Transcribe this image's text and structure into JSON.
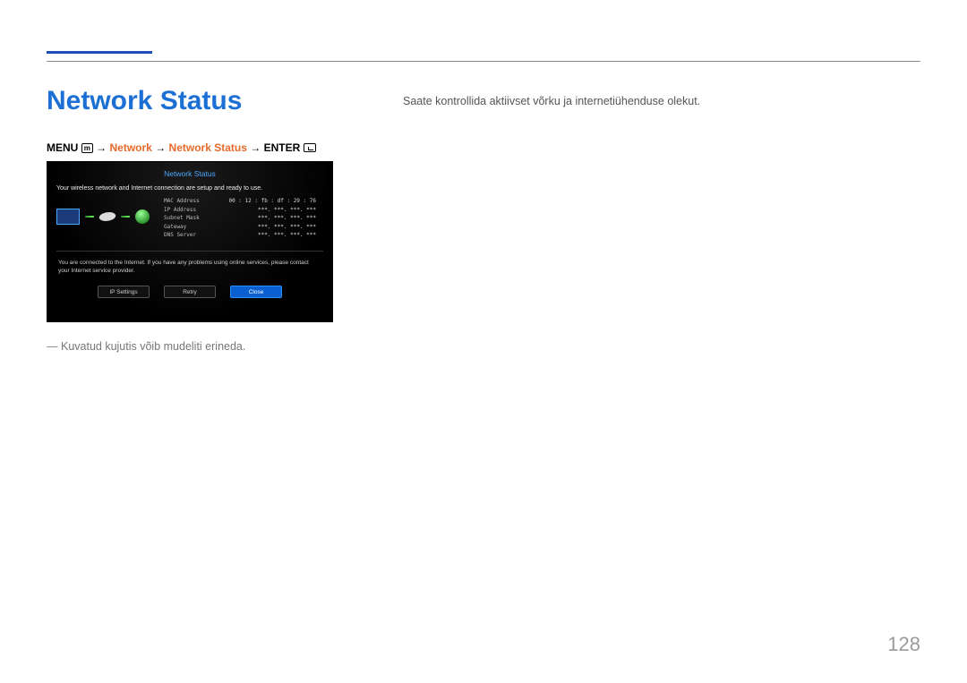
{
  "page_title": "Network Status",
  "right_description": "Saate kontrollida aktiivset võrku ja internetiühenduse olekut.",
  "menu_path": {
    "p1": "MENU",
    "arrow": "→",
    "p2": "Network",
    "p3": "Network Status",
    "p4": "ENTER"
  },
  "tv": {
    "title": "Network Status",
    "msg1": "Your wireless network and Internet connection are setup and ready to use.",
    "details": [
      {
        "lbl": "MAC Address",
        "val": "00 : 12 : fb : df : 29 : 76"
      },
      {
        "lbl": "IP Address",
        "val": "***.  ***.  ***.  ***"
      },
      {
        "lbl": "Subnet Mask",
        "val": "***.  ***.  ***.  ***"
      },
      {
        "lbl": "Gateway",
        "val": "***.  ***.  ***.  ***"
      },
      {
        "lbl": "DNS Server",
        "val": "***.  ***.  ***.  ***"
      }
    ],
    "msg2": "You are connected to the Internet. If you have any problems using online services, please contact your Internet service provider.",
    "buttons": {
      "ip_settings": "IP Settings",
      "retry": "Retry",
      "close": "Close"
    }
  },
  "note": "Kuvatud kujutis võib mudeliti erineda.",
  "page_number": "128"
}
